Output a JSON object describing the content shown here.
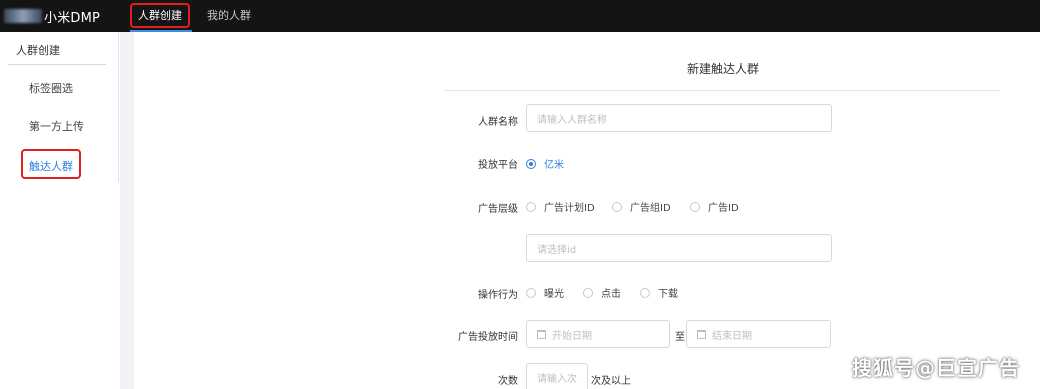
{
  "app": {
    "title": "小米DMP"
  },
  "top_tabs": [
    {
      "label": "人群创建"
    },
    {
      "label": "我的人群"
    }
  ],
  "sidebar": {
    "title": "人群创建",
    "items": [
      {
        "label": "标签圈选"
      },
      {
        "label": "第一方上传"
      },
      {
        "label": "触达人群"
      }
    ]
  },
  "form": {
    "title": "新建触达人群",
    "name": {
      "label": "人群名称",
      "placeholder": "请输入人群名称"
    },
    "platform": {
      "label": "投放平台",
      "options": [
        "亿米"
      ],
      "selected": "亿米"
    },
    "ad_level": {
      "label": "广告层级",
      "options": [
        "广告计划ID",
        "广告组ID",
        "广告ID"
      ],
      "id_placeholder": "请选择id"
    },
    "action": {
      "label": "操作行为",
      "options": [
        "曝光",
        "点击",
        "下载"
      ]
    },
    "ad_time": {
      "label": "广告投放时间",
      "start_placeholder": "开始日期",
      "separator": "至",
      "end_placeholder": "结束日期"
    },
    "count": {
      "label": "次数",
      "placeholder": "请输入次",
      "suffix": "次及以上"
    }
  },
  "watermark": "搜狐号@巨宣广告",
  "colors": {
    "accent": "#2f7fe0",
    "topbar": "#141414",
    "highlight": "#e02020"
  }
}
